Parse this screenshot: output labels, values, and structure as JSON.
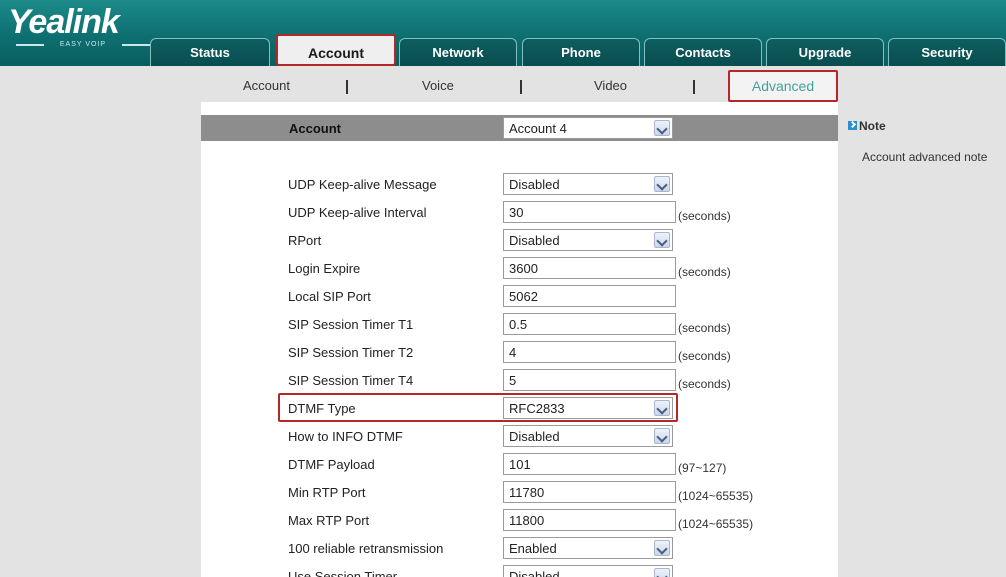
{
  "brand": {
    "logo_text": "Yealink",
    "tagline": "EASY VOIP"
  },
  "tabs": [
    {
      "label": "Status"
    },
    {
      "label": "Account"
    },
    {
      "label": "Network"
    },
    {
      "label": "Phone"
    },
    {
      "label": "Contacts"
    },
    {
      "label": "Upgrade"
    },
    {
      "label": "Security"
    }
  ],
  "subnav": {
    "items": [
      "Account",
      "Voice",
      "Video"
    ],
    "active": "Advanced"
  },
  "account_bar": {
    "label": "Account",
    "selected": "Account 4"
  },
  "rows": [
    {
      "label": "UDP Keep-alive Message",
      "kind": "select",
      "value": "Disabled"
    },
    {
      "label": "UDP Keep-alive Interval",
      "kind": "input",
      "value": "30",
      "unit": "(seconds)"
    },
    {
      "label": "RPort",
      "kind": "select",
      "value": "Disabled"
    },
    {
      "label": "Login Expire",
      "kind": "input",
      "value": "3600",
      "unit": "(seconds)"
    },
    {
      "label": "Local SIP Port",
      "kind": "input",
      "value": "5062"
    },
    {
      "label": "SIP Session Timer T1",
      "kind": "input",
      "value": "0.5",
      "unit": "(seconds)"
    },
    {
      "label": "SIP Session Timer T2",
      "kind": "input",
      "value": "4",
      "unit": "(seconds)"
    },
    {
      "label": "SIP Session Timer T4",
      "kind": "input",
      "value": "5",
      "unit": "(seconds)"
    },
    {
      "label": "DTMF Type",
      "kind": "select",
      "value": "RFC2833"
    },
    {
      "label": "How to INFO DTMF",
      "kind": "select",
      "value": "Disabled"
    },
    {
      "label": "DTMF Payload",
      "kind": "input",
      "value": "101",
      "unit": "(97~127)"
    },
    {
      "label": "Min RTP Port",
      "kind": "input",
      "value": "11780",
      "unit": "(1024~65535)"
    },
    {
      "label": "Max RTP Port",
      "kind": "input",
      "value": "11800",
      "unit": "(1024~65535)"
    },
    {
      "label": "100 reliable retransmission",
      "kind": "select",
      "value": "Enabled"
    },
    {
      "label": "Use Session Timer",
      "kind": "select",
      "value": "Disabled"
    }
  ],
  "note": {
    "title": "Note",
    "text": "Account advanced note"
  },
  "colors": {
    "header_teal": "#0e6f70",
    "highlight_red": "#b32929",
    "active_sub_text": "#41a29c",
    "panel_gray": "#e3e3e3",
    "bar_gray": "#8d8d8d"
  }
}
